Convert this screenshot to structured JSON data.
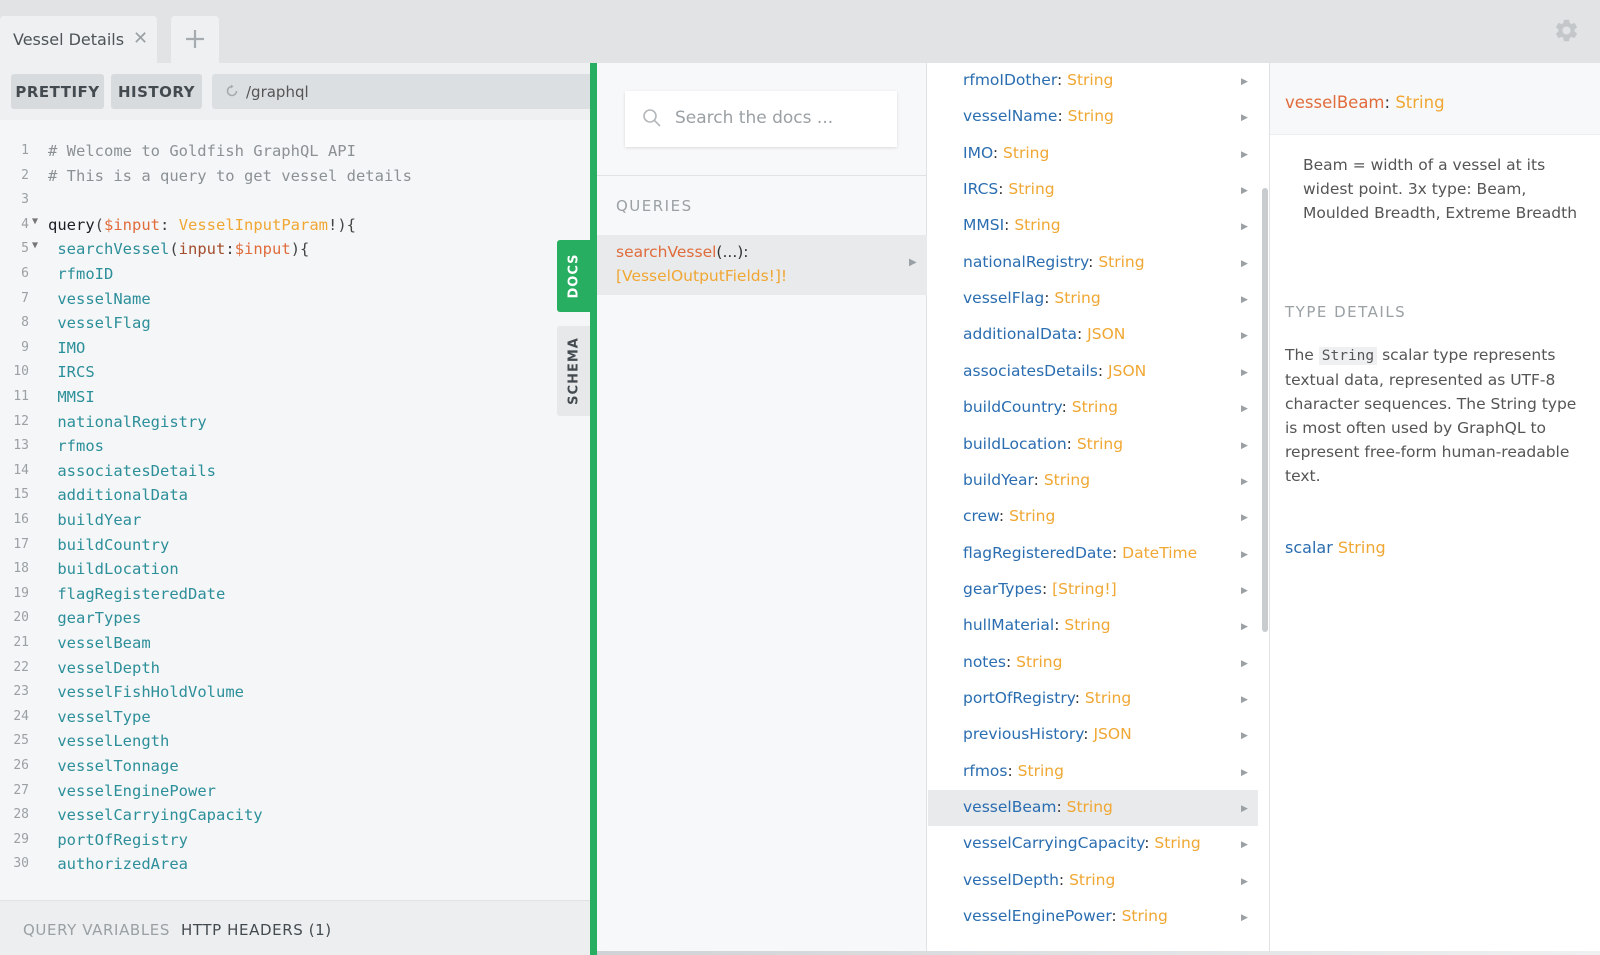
{
  "tabs": [
    {
      "label": "Vessel Details"
    }
  ],
  "editor": {
    "prettify_label": "PRETTIFY",
    "history_label": "HISTORY",
    "url": "/graphql",
    "lines": [
      {
        "n": "1",
        "comment": "# Welcome to Goldfish GraphQL API"
      },
      {
        "n": "2",
        "comment": "# This is a query to get vessel details"
      },
      {
        "n": "3"
      },
      {
        "n": "4",
        "kw": "query",
        "p1": "(",
        "var": "$input",
        "p2": ": ",
        "type": "VesselInputParam",
        "p3": "!){"
      },
      {
        "n": "5",
        "field": "searchVessel",
        "p1": "(",
        "attr": "input",
        "p2": ":",
        "var": "$input",
        "p3": "){"
      },
      {
        "n": "6",
        "field": "rfmoID"
      },
      {
        "n": "7",
        "field": "vesselName"
      },
      {
        "n": "8",
        "field": "vesselFlag"
      },
      {
        "n": "9",
        "field": "IMO"
      },
      {
        "n": "10",
        "field": "IRCS"
      },
      {
        "n": "11",
        "field": "MMSI"
      },
      {
        "n": "12",
        "field": "nationalRegistry"
      },
      {
        "n": "13",
        "field": "rfmos"
      },
      {
        "n": "14",
        "field": "associatesDetails"
      },
      {
        "n": "15",
        "field": "additionalData"
      },
      {
        "n": "16",
        "field": "buildYear"
      },
      {
        "n": "17",
        "field": "buildCountry"
      },
      {
        "n": "18",
        "field": "buildLocation"
      },
      {
        "n": "19",
        "field": "flagRegisteredDate"
      },
      {
        "n": "20",
        "field": "gearTypes"
      },
      {
        "n": "21",
        "field": "vesselBeam"
      },
      {
        "n": "22",
        "field": "vesselDepth"
      },
      {
        "n": "23",
        "field": "vesselFishHoldVolume"
      },
      {
        "n": "24",
        "field": "vesselType"
      },
      {
        "n": "25",
        "field": "vesselLength"
      },
      {
        "n": "26",
        "field": "vesselTonnage"
      },
      {
        "n": "27",
        "field": "vesselEnginePower"
      },
      {
        "n": "28",
        "field": "vesselCarryingCapacity"
      },
      {
        "n": "29",
        "field": "portOfRegistry"
      },
      {
        "n": "30",
        "field": "authorizedArea"
      }
    ],
    "query_variables_label": "QUERY VARIABLES",
    "http_headers_label": "HTTP HEADERS (1)"
  },
  "side_tabs": {
    "docs": "DOCS",
    "schema": "SCHEMA"
  },
  "docs": {
    "search_placeholder": "Search the docs ...",
    "queries_header": "QUERIES",
    "query": {
      "name": "searchVessel",
      "args": "(...):",
      "type": "[VesselOutputFields!]!"
    },
    "fields": [
      {
        "name": "rfmoIDother",
        "type": "String"
      },
      {
        "name": "vesselName",
        "type": "String"
      },
      {
        "name": "IMO",
        "type": "String"
      },
      {
        "name": "IRCS",
        "type": "String"
      },
      {
        "name": "MMSI",
        "type": "String"
      },
      {
        "name": "nationalRegistry",
        "type": "String"
      },
      {
        "name": "vesselFlag",
        "type": "String"
      },
      {
        "name": "additionalData",
        "type": "JSON"
      },
      {
        "name": "associatesDetails",
        "type": "JSON"
      },
      {
        "name": "buildCountry",
        "type": "String"
      },
      {
        "name": "buildLocation",
        "type": "String"
      },
      {
        "name": "buildYear",
        "type": "String"
      },
      {
        "name": "crew",
        "type": "String"
      },
      {
        "name": "flagRegisteredDate",
        "type": "DateTime"
      },
      {
        "name": "gearTypes",
        "type": "[String!]"
      },
      {
        "name": "hullMaterial",
        "type": "String"
      },
      {
        "name": "notes",
        "type": "String"
      },
      {
        "name": "portOfRegistry",
        "type": "String"
      },
      {
        "name": "previousHistory",
        "type": "JSON"
      },
      {
        "name": "rfmos",
        "type": "String"
      },
      {
        "name": "vesselBeam",
        "type": "String",
        "selected": true
      },
      {
        "name": "vesselCarryingCapacity",
        "type": "String"
      },
      {
        "name": "vesselDepth",
        "type": "String"
      },
      {
        "name": "vesselEnginePower",
        "type": "String"
      }
    ],
    "detail": {
      "field_name": "vesselBeam",
      "field_type": "String",
      "description": "Beam = width of a vessel at its widest point. 3x type: Beam, Moulded Breadth, Extreme Breadth",
      "type_details_header": "TYPE DETAILS",
      "type_desc_pre": "The ",
      "type_desc_code": "String",
      "type_desc_post": " scalar type represents textual data, represented as UTF-8 character sequences. The String type is most often used by GraphQL to represent free-form human-readable text.",
      "scalar_kw": "scalar",
      "scalar_type": "String"
    }
  },
  "colors": {
    "accent": "#27ae60",
    "field": "#2a6db0",
    "type": "#f0a733",
    "name": "#e06c3c"
  },
  "icons": {
    "tab_close": "close-icon",
    "tab_add": "plus-icon",
    "settings": "gear-icon",
    "url_reload": "reload-icon",
    "search": "search-icon",
    "expand": "chevron-right-icon"
  }
}
